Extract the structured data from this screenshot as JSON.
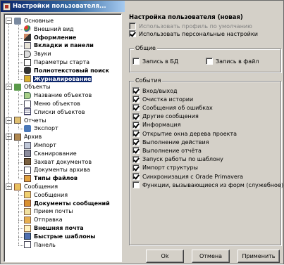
{
  "window": {
    "title": "Настройки пользователя..."
  },
  "tree": [
    {
      "label": "Основные",
      "bold": false,
      "level": 0,
      "icon": "wrench-icon",
      "expander": "−"
    },
    {
      "label": "Внешний вид",
      "bold": false,
      "level": 1,
      "icon": "palette-icon"
    },
    {
      "label": "Оформление",
      "bold": true,
      "level": 1,
      "icon": "brush-icon"
    },
    {
      "label": "Вкладки и панели",
      "bold": true,
      "level": 1,
      "icon": "tabs-icon"
    },
    {
      "label": "Звуки",
      "bold": false,
      "level": 1,
      "icon": "speaker-icon"
    },
    {
      "label": "Параметры старта",
      "bold": false,
      "level": 1,
      "icon": "checklist-icon"
    },
    {
      "label": "Полнотекстовый поиск",
      "bold": true,
      "level": 1,
      "icon": "binoculars-icon"
    },
    {
      "label": "Журналирование",
      "bold": true,
      "level": 1,
      "icon": "journal-icon",
      "selected": true
    },
    {
      "label": "Объекты",
      "bold": false,
      "level": 0,
      "icon": "objects-icon",
      "expander": "−"
    },
    {
      "label": "Название объектов",
      "bold": false,
      "level": 1,
      "icon": "tag-icon"
    },
    {
      "label": "Меню объектов",
      "bold": false,
      "level": 1,
      "icon": "menu-icon"
    },
    {
      "label": "Списки объектов",
      "bold": false,
      "level": 1,
      "icon": "grid-icon"
    },
    {
      "label": "Отчеты",
      "bold": false,
      "level": 0,
      "icon": "report-icon",
      "expander": "−"
    },
    {
      "label": "Экспорт",
      "bold": false,
      "level": 1,
      "icon": "export-icon"
    },
    {
      "label": "Архив",
      "bold": false,
      "level": 0,
      "icon": "archive-icon",
      "expander": "−"
    },
    {
      "label": "Импорт",
      "bold": false,
      "level": 1,
      "icon": "import-icon"
    },
    {
      "label": "Сканирование",
      "bold": false,
      "level": 1,
      "icon": "scanner-icon"
    },
    {
      "label": "Захват документов",
      "bold": false,
      "level": 1,
      "icon": "capture-icon"
    },
    {
      "label": "Документы архива",
      "bold": false,
      "level": 1,
      "icon": "document-icon"
    },
    {
      "label": "Типы файлов",
      "bold": true,
      "level": 1,
      "icon": "filetypes-icon"
    },
    {
      "label": "Сообщения",
      "bold": false,
      "level": 0,
      "icon": "messages-icon",
      "expander": "−"
    },
    {
      "label": "Сообщения",
      "bold": false,
      "level": 1,
      "icon": "message-icon"
    },
    {
      "label": "Документы сообщений",
      "bold": true,
      "level": 1,
      "icon": "message-docs-icon"
    },
    {
      "label": "Прием почты",
      "bold": false,
      "level": 1,
      "icon": "inbox-icon"
    },
    {
      "label": "Отправка",
      "bold": false,
      "level": 1,
      "icon": "send-icon"
    },
    {
      "label": "Внешняя почта",
      "bold": true,
      "level": 1,
      "icon": "external-mail-icon"
    },
    {
      "label": "Быстрые шаблоны",
      "bold": true,
      "level": 1,
      "icon": "templates-icon"
    },
    {
      "label": "Панель",
      "bold": false,
      "level": 1,
      "icon": "panel-icon"
    }
  ],
  "settings": {
    "title": "Настройка пользователя (новая)",
    "use_default_profile": {
      "label": "Использовать профиль по умолчанию",
      "checked": false,
      "disabled": true
    },
    "use_personal": {
      "label": "Использовать персональные настройки",
      "checked": true,
      "disabled": false
    }
  },
  "general": {
    "label": "Общие",
    "log_db": {
      "label": "Запись в БД",
      "checked": false
    },
    "log_file": {
      "label": "Запись в файл",
      "checked": false
    }
  },
  "events": {
    "label": "События",
    "items": [
      {
        "label": "Вход/выход",
        "checked": true
      },
      {
        "label": "Очистка истории",
        "checked": true
      },
      {
        "label": "Сообщения об ошибках",
        "checked": true
      },
      {
        "label": "Другие сообщения",
        "checked": true
      },
      {
        "label": "Информация",
        "checked": true
      },
      {
        "label": "Открытие окна дерева проекта",
        "checked": true
      },
      {
        "label": "Выполнение действия",
        "checked": true
      },
      {
        "label": "Выполнение отчёта",
        "checked": true
      },
      {
        "label": "Запуск работы по шаблону",
        "checked": true
      },
      {
        "label": "Импорт структуры",
        "checked": true
      },
      {
        "label": "Синхронизация с Orade Primavera",
        "checked": true
      },
      {
        "label": "Функции, вызывающиеся из форм (служебное)",
        "checked": false
      }
    ]
  },
  "buttons": {
    "ok": "Ok",
    "cancel": "Отмена",
    "apply": "Применить"
  }
}
